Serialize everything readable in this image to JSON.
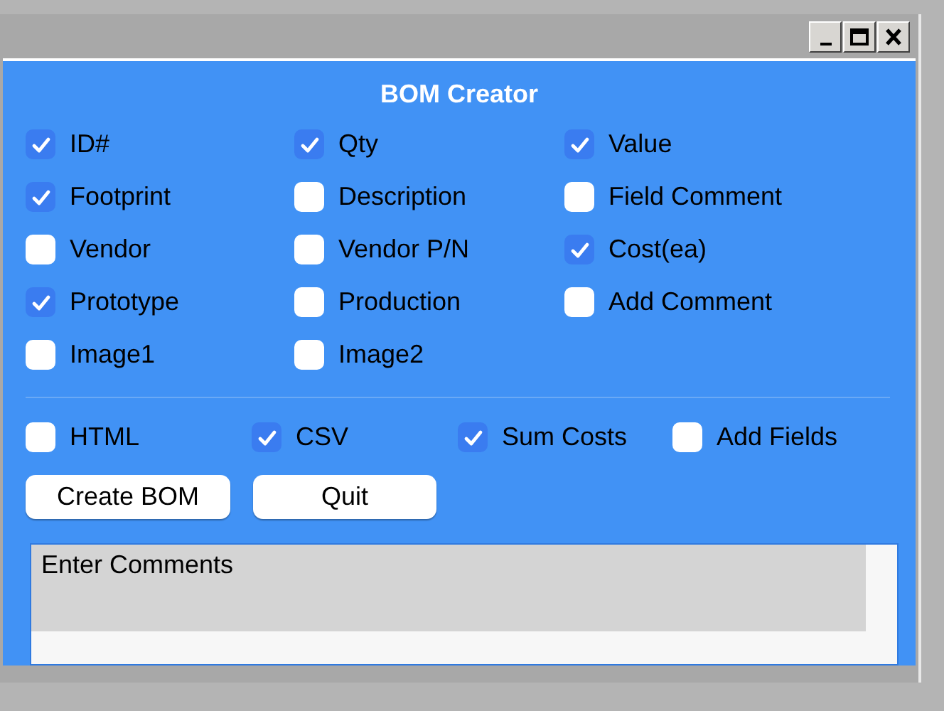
{
  "window": {
    "title": "BOM Creator"
  },
  "field_options": [
    {
      "label": "ID#",
      "checked": true
    },
    {
      "label": "Qty",
      "checked": true
    },
    {
      "label": "Value",
      "checked": true
    },
    {
      "label": "Footprint",
      "checked": true
    },
    {
      "label": "Description",
      "checked": false
    },
    {
      "label": "Field Comment",
      "checked": false
    },
    {
      "label": "Vendor",
      "checked": false
    },
    {
      "label": "Vendor P/N",
      "checked": false
    },
    {
      "label": "Cost(ea)",
      "checked": true
    },
    {
      "label": "Prototype",
      "checked": true
    },
    {
      "label": "Production",
      "checked": false
    },
    {
      "label": "Add Comment",
      "checked": false
    },
    {
      "label": "Image1",
      "checked": false
    },
    {
      "label": "Image2",
      "checked": false
    }
  ],
  "output_options": [
    {
      "label": "HTML",
      "checked": false
    },
    {
      "label": "CSV",
      "checked": true
    },
    {
      "label": "Sum Costs",
      "checked": true
    },
    {
      "label": "Add Fields",
      "checked": false
    }
  ],
  "buttons": [
    "Create BOM",
    "Quit"
  ],
  "comments": {
    "value": "Enter Comments"
  }
}
